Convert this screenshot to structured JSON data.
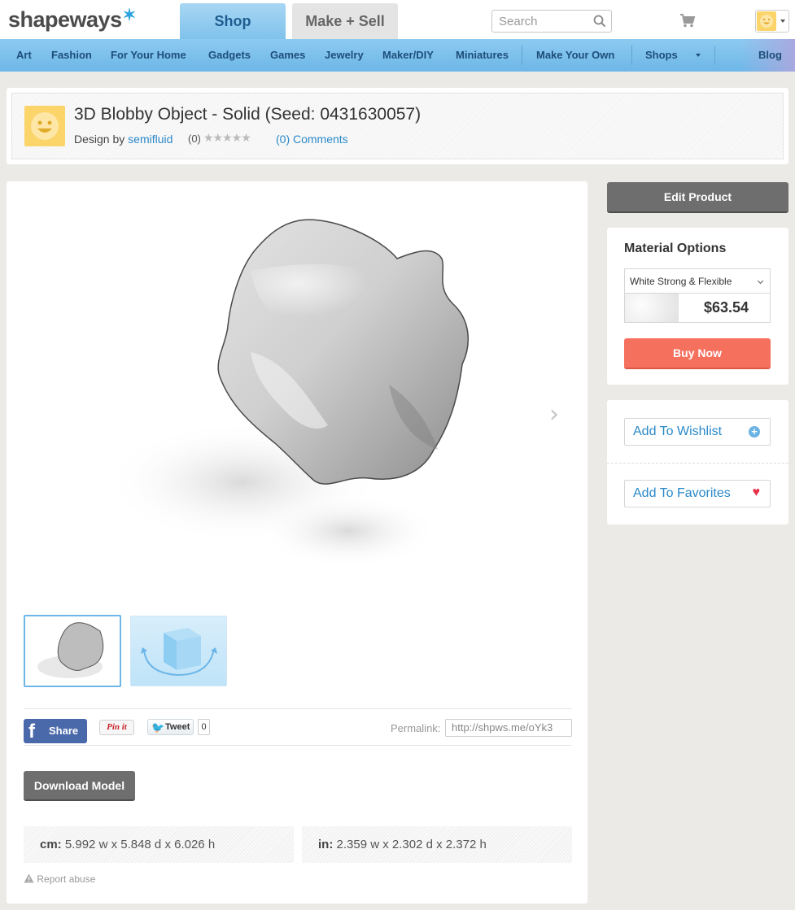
{
  "header": {
    "logo_text": "shapeways",
    "tab_shop": "Shop",
    "tab_make_sell": "Make + Sell",
    "search_placeholder": "Search"
  },
  "nav": {
    "items": [
      "Art",
      "Fashion",
      "For Your Home",
      "Gadgets",
      "Games",
      "Jewelry",
      "Maker/DIY",
      "Miniatures",
      "Make Your Own",
      "Shops",
      "Blog"
    ]
  },
  "product": {
    "title": "3D Blobby Object - Solid (Seed: 0431630057)",
    "design_by_prefix": "Design by",
    "designer": "semifluid",
    "rating_count": "(0)",
    "stars": "★★★★★",
    "comments": "(0) Comments"
  },
  "share": {
    "facebook_label": "Share",
    "pinterest_label": "Pin it",
    "tweet_label": "Tweet",
    "tweet_count": "0",
    "permalink_label": "Permalink:",
    "permalink_value": "http://shpws.me/oYk3"
  },
  "actions": {
    "download_label": "Download Model",
    "edit_label": "Edit Product",
    "buy_label": "Buy Now",
    "wishlist_label": "Add To Wishlist",
    "favorites_label": "Add To Favorites",
    "report_label": "Report abuse"
  },
  "material": {
    "title": "Material Options",
    "selected": "White Strong & Flexible",
    "price": "$63.54"
  },
  "dimensions": {
    "cm_label": "cm:",
    "cm_value": "5.992 w x 5.848 d x 6.026 h",
    "in_label": "in:",
    "in_value": "2.359 w x 2.302 d x 2.372 h"
  },
  "colors": {
    "accent_blue": "#6db7e8",
    "buy_red": "#f6705e",
    "link_blue": "#2a89c9",
    "facebook_blue": "#4a69ab"
  }
}
